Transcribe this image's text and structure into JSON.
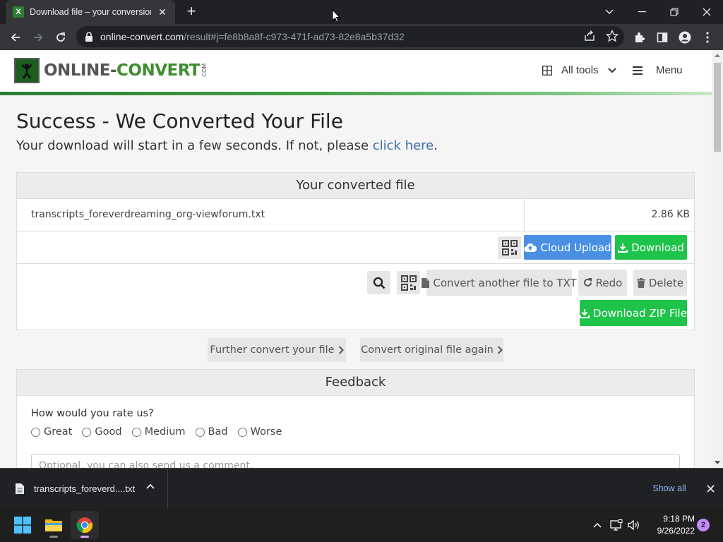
{
  "browser": {
    "tab_title": "Download file – your conversion",
    "tab_favicon": "X",
    "url_domain": "online-convert.com",
    "url_path": "/result#j=fe8b8a8f-c973-471f-ad73-82e8a5b37d32"
  },
  "site": {
    "logo_online": "ONLINE-",
    "logo_convert": "CONVERT",
    "logo_com": ".COM",
    "all_tools": "All tools",
    "menu": "Menu"
  },
  "main": {
    "title": "Success - We Converted Your File",
    "subtitle_prefix": "Your download will start in a few seconds. If not, please ",
    "subtitle_link": "click here",
    "subtitle_suffix": "."
  },
  "converted": {
    "header": "Your converted file",
    "file_name": "transcripts_foreverdreaming_org-viewforum.txt",
    "file_size": "2.86 KB",
    "cloud_upload": "Cloud Upload",
    "download": "Download",
    "convert_another": "Convert another file to TXT",
    "redo": "Redo",
    "delete": "Delete",
    "download_zip": "Download ZIP File"
  },
  "further": {
    "further_convert": "Further convert your file",
    "convert_original": "Convert original file again"
  },
  "feedback": {
    "header": "Feedback",
    "question": "How would you rate us?",
    "options": [
      "Great",
      "Good",
      "Medium",
      "Bad",
      "Worse"
    ],
    "comment_placeholder": "Optional, you can also send us a comment."
  },
  "shelf": {
    "file": "transcripts_foreverd....txt",
    "show_all": "Show all"
  },
  "taskbar": {
    "time": "9:18 PM",
    "date": "9/26/2022",
    "notifications": "2"
  },
  "colors": {
    "brand_green": "#3e8e2f",
    "cloud_blue": "#4a90e2",
    "download_green": "#1ec34a"
  }
}
